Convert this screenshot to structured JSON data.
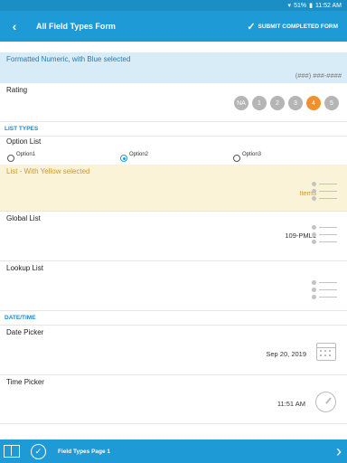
{
  "status": {
    "battery": "51%",
    "time": "11:52 AM"
  },
  "header": {
    "back_icon": "back-arrow-icon",
    "title": "All Field Types Form",
    "submit_label": "SUBMIT COMPLETED FORM"
  },
  "fields": {
    "formatted_numeric": {
      "label": "Formatted Numeric, with Blue selected",
      "value": "(###) ###-####"
    },
    "rating": {
      "label": "Rating",
      "options": [
        "NA",
        "1",
        "2",
        "3",
        "4",
        "5"
      ],
      "selected": "4"
    },
    "option_list": {
      "label": "Option List",
      "options": [
        "Option1",
        "Option2",
        "Option3"
      ],
      "selected": "Option2"
    },
    "list_yellow": {
      "label": "List - With Yellow selected",
      "value": "Item3"
    },
    "global_list": {
      "label": "Global List",
      "value": "109-PML1"
    },
    "lookup_list": {
      "label": "Lookup List",
      "value": ""
    },
    "date_picker": {
      "label": "Date Picker",
      "value": "Sep 20, 2019"
    },
    "time_picker": {
      "label": "Time Picker",
      "value": "11:51 AM"
    }
  },
  "sections": {
    "list_types": "LIST TYPES",
    "date_time": "DATE/TIME"
  },
  "footer": {
    "page_label": "Field Types Page 1"
  },
  "colors": {
    "primary": "#1e9bd7",
    "accent": "#f0902e",
    "blue_highlight": "#d8ecf7",
    "yellow_highlight": "#fbf3d8"
  }
}
